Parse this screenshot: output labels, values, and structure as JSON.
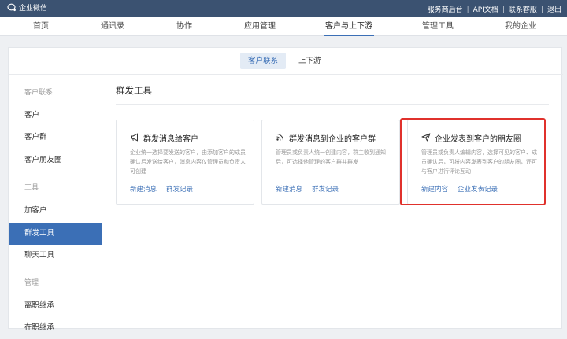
{
  "app": {
    "title": "企业微信"
  },
  "top_links": [
    "服务商后台",
    "API文档",
    "联系客服",
    "退出"
  ],
  "nav": [
    {
      "label": "首页",
      "active": false
    },
    {
      "label": "通讯录",
      "active": false
    },
    {
      "label": "协作",
      "active": false
    },
    {
      "label": "应用管理",
      "active": false
    },
    {
      "label": "客户与上下游",
      "active": true
    },
    {
      "label": "管理工具",
      "active": false
    },
    {
      "label": "我的企业",
      "active": false
    }
  ],
  "subtabs": [
    {
      "label": "客户联系",
      "active": true
    },
    {
      "label": "上下游",
      "active": false
    }
  ],
  "sidebar": [
    {
      "label": "客户联系",
      "type": "header"
    },
    {
      "label": "客户",
      "type": "item"
    },
    {
      "label": "客户群",
      "type": "item"
    },
    {
      "label": "客户朋友圈",
      "type": "item"
    },
    {
      "label": "工具",
      "type": "header"
    },
    {
      "label": "加客户",
      "type": "item"
    },
    {
      "label": "群发工具",
      "type": "item",
      "active": true
    },
    {
      "label": "聊天工具",
      "type": "item"
    },
    {
      "label": "管理",
      "type": "header"
    },
    {
      "label": "离职继承",
      "type": "item"
    },
    {
      "label": "在职继承",
      "type": "item"
    }
  ],
  "main": {
    "title": "群发工具",
    "cards": [
      {
        "icon": "megaphone-icon",
        "title": "群发消息给客户",
        "desc": "企业统一选择要发送的客户，由添加客户的成员确认后发送给客户，消息内容仅管理员和负责人可创建",
        "links": [
          "新建消息",
          "群发记录"
        ]
      },
      {
        "icon": "broadcast-icon",
        "title": "群发消息到企业的客户群",
        "desc": "管理员或负责人统一创建内容，群主收到通知后，可选择他管理的客户群并群发",
        "links": [
          "新建消息",
          "群发记录"
        ]
      },
      {
        "icon": "send-icon",
        "title": "企业发表到客户的朋友圈",
        "desc": "管理员或负责人编辑内容，选择可见的客户、成员确认后，可将内容发表到客户的朋友圈，还可与客户进行评论互动",
        "links": [
          "新建内容",
          "企业发表记录"
        ]
      }
    ]
  },
  "colors": {
    "topbar": "#3b5271",
    "accent": "#3b6fb6",
    "highlight": "#e0312c"
  }
}
